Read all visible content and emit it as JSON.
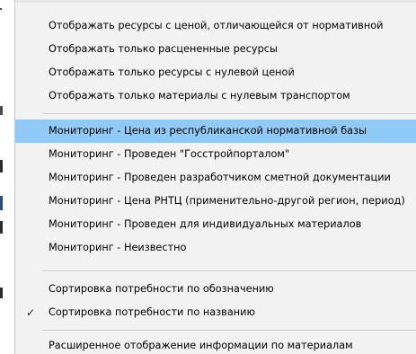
{
  "menu": {
    "items": [
      {
        "label": "Отображать ресурсы с ценой, отличающейся от нормативной"
      },
      {
        "label": "Отображать только расцененные ресурсы"
      },
      {
        "label": "Отображать только ресурсы с нулевой ценой"
      },
      {
        "label": "Отображать только материалы с нулевым транспортом"
      },
      {
        "label": "Мониторинг - Цена из республиканской нормативной базы",
        "highlighted": true
      },
      {
        "label": "Мониторинг - Проведен \"Госстройпорталом\""
      },
      {
        "label": "Мониторинг - Проведен разработчиком сметной документации"
      },
      {
        "label": "Мониторинг - Цена РНТЦ (применительно-другой регион, период)"
      },
      {
        "label": "Мониторинг - Проведен для индивидуальных материалов"
      },
      {
        "label": "Мониторинг - Неизвестно"
      },
      {
        "label": "Сортировка потребности по обозначению"
      },
      {
        "label": "Сортировка потребности по названию",
        "checked": true,
        "check_glyph": "✓"
      },
      {
        "label": "Расширенное отображение информации по материалам"
      }
    ],
    "highlight_color": "#91c9f7"
  }
}
